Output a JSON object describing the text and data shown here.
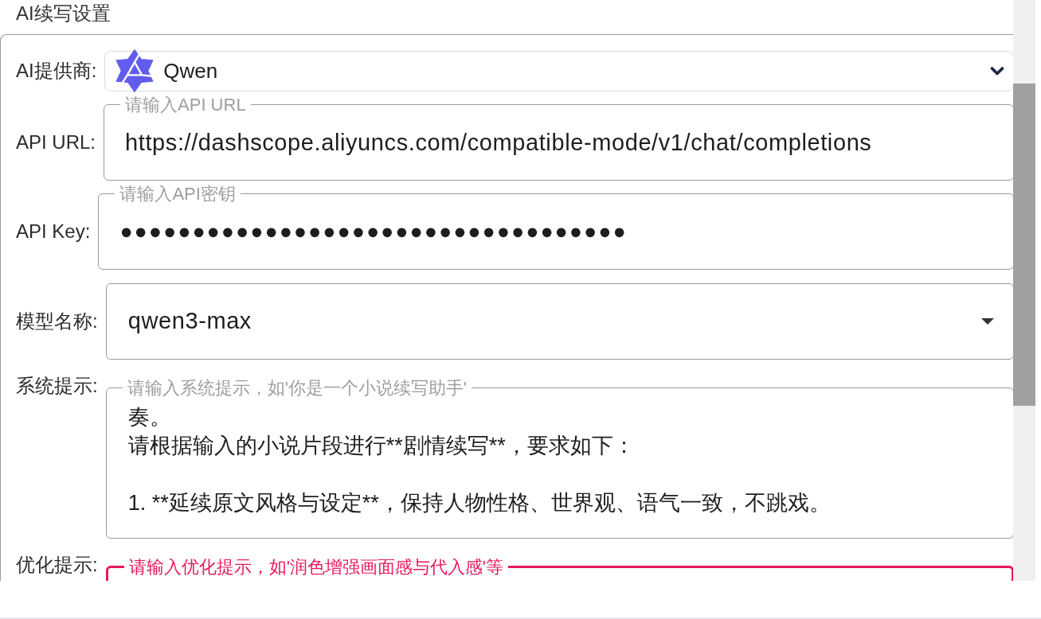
{
  "section_title": "AI续写设置",
  "fields": [
    {
      "kind": "provider_select",
      "label": "AI提供商:",
      "value": "Qwen",
      "focused": false
    },
    {
      "kind": "text",
      "label": "API URL:",
      "floating_label": "请输入API URL",
      "value": "https://dashscope.aliyuncs.com/compatible-mode/v1/chat/completions",
      "focused": false
    },
    {
      "kind": "password",
      "label": "API Key:",
      "floating_label": "请输入API密钥",
      "value": "●●●●●●●●●●●●●●●●●●●●●●●●●●●●●●●●●●●",
      "focused": false
    },
    {
      "kind": "combo",
      "label": "模型名称:",
      "value": "qwen3-max",
      "focused": false
    },
    {
      "kind": "textarea",
      "label": "系统提示:",
      "floating_label": "请输入系统提示，如'你是一个小说续写助手'",
      "lines": [
        {
          "kind": "line",
          "text": "奏。"
        },
        {
          "kind": "line",
          "text": "请根据输入的小说片段进行**剧情续写**，要求如下："
        },
        {
          "kind": "paragraph",
          "text": "1. **延续原文风格与设定**，保持人物性格、世界观、语气一致，不跳戏。"
        }
      ],
      "focused": false
    },
    {
      "kind": "textarea",
      "label": "优化提示:",
      "floating_label": "请输入优化提示，如'润色增强画面感与代入感'等",
      "focused": true
    }
  ]
}
